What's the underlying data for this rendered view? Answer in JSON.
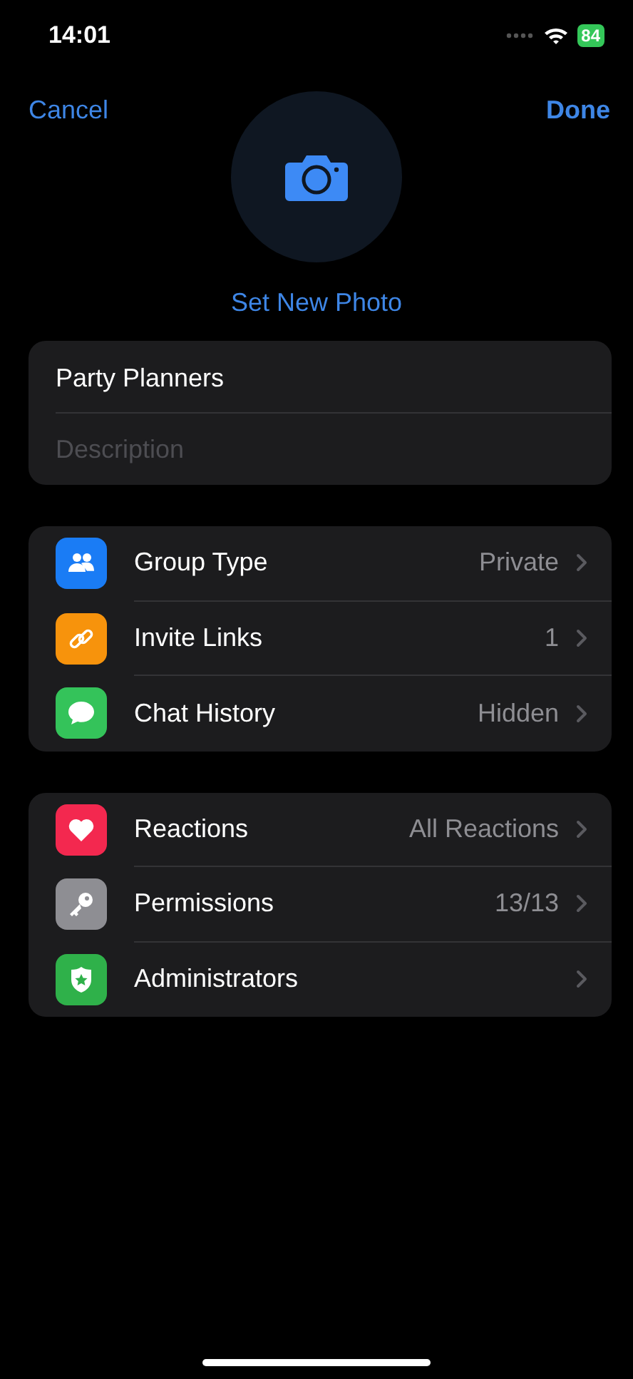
{
  "status_bar": {
    "time": "14:01",
    "battery": "84"
  },
  "nav": {
    "cancel": "Cancel",
    "done": "Done"
  },
  "photo": {
    "label": "Set New Photo"
  },
  "fields": {
    "name": "Party Planners",
    "description_placeholder": "Description"
  },
  "sections": [
    {
      "items": [
        {
          "label": "Group Type",
          "value": "Private",
          "color": "#1a7cf5"
        },
        {
          "label": "Invite Links",
          "value": "1",
          "color": "#f7930c"
        },
        {
          "label": "Chat History",
          "value": "Hidden",
          "color": "#34c35a"
        }
      ]
    },
    {
      "items": [
        {
          "label": "Reactions",
          "value": "All Reactions",
          "color": "#f3284f"
        },
        {
          "label": "Permissions",
          "value": "13/13",
          "color": "#8e8e93"
        },
        {
          "label": "Administrators",
          "color": "#2fb14a"
        }
      ]
    }
  ]
}
